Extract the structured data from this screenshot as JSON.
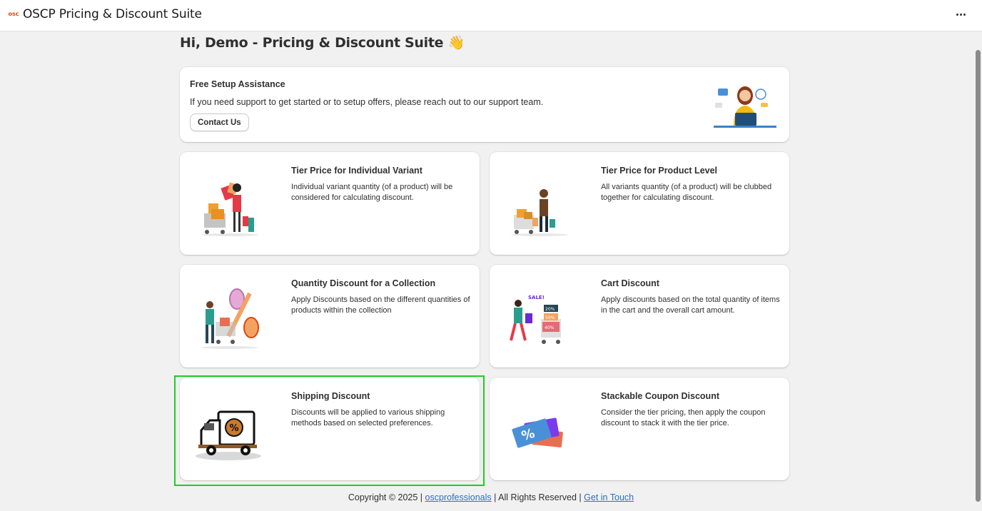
{
  "app": {
    "logo_text": "osc",
    "title": "OSCP Pricing & Discount Suite"
  },
  "page": {
    "greeting": "Hi, Demo - Pricing & Discount Suite 👋"
  },
  "setup": {
    "title": "Free Setup Assistance",
    "description": "If you need support to get started or to setup offers, please reach out to our support team.",
    "contact_label": "Contact Us"
  },
  "features": [
    {
      "title": "Tier Price for Individual Variant",
      "description": "Individual variant quantity (of a product) will be considered for calculating discount."
    },
    {
      "title": "Tier Price for Product Level",
      "description": "All variants quantity (of a product) will be clubbed together for calculating discount."
    },
    {
      "title": "Quantity Discount for a Collection",
      "description": "Apply Discounts based on the different quantities of products within the collection"
    },
    {
      "title": "Cart Discount",
      "description": "Apply discounts based on the total quantity of items in the cart and the overall cart amount."
    },
    {
      "title": "Shipping Discount",
      "description": "Discounts will be applied to various shipping methods based on selected preferences."
    },
    {
      "title": "Stackable Coupon Discount",
      "description": "Consider the tier pricing, then apply the coupon discount to stack it with the tier price."
    }
  ],
  "illustration_labels": {
    "sale": "SALE!",
    "tag_20": "20%",
    "tag_50": "50%",
    "tag_40": "40%"
  },
  "footer": {
    "copyright": "Copyright © 2025 |",
    "company_link": "oscprofessionals",
    "rights": "| All Rights Reserved |",
    "contact_link": "Get in Touch"
  },
  "colors": {
    "background": "#f1f1f1",
    "card": "#ffffff",
    "text": "#303030",
    "link": "#2c6ecb",
    "highlight": "#22cc22"
  },
  "icons": [
    "osc-logo-icon",
    "more-options-icon",
    "support-agent-illustration",
    "shopping-illustration",
    "discount-truck-illustration",
    "coupon-illustration"
  ]
}
